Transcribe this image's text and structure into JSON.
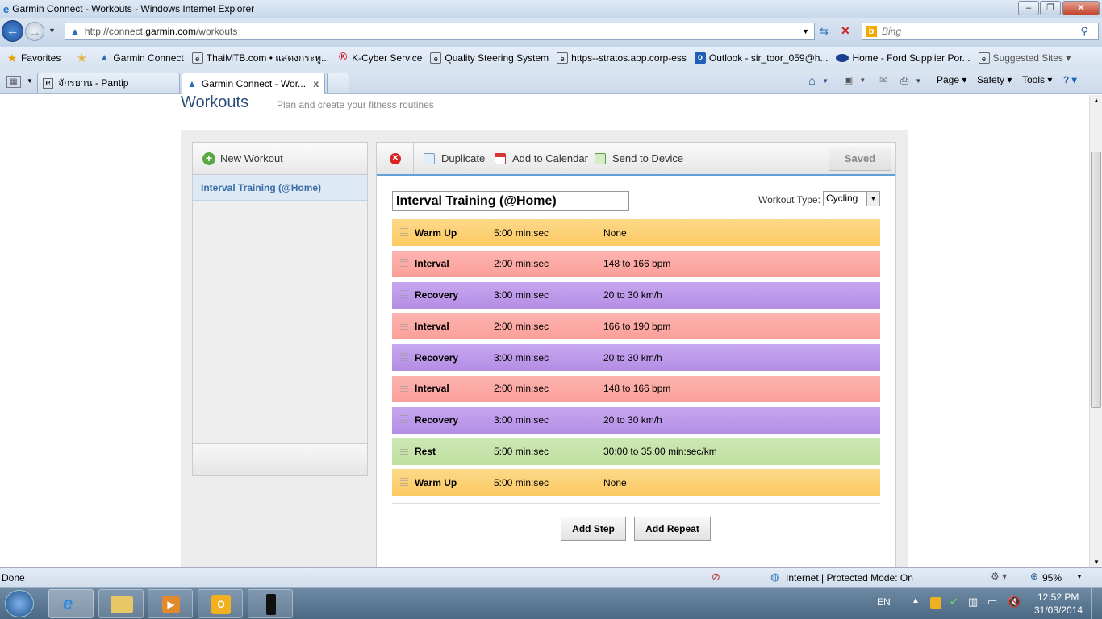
{
  "window": {
    "title": "Garmin Connect - Workouts - Windows Internet Explorer"
  },
  "address": {
    "url_prefix": "http://connect.",
    "url_domain": "garmin.com",
    "url_path": "/workouts",
    "search_placeholder": "Bing"
  },
  "favorites": {
    "label": "Favorites",
    "items": [
      "Garmin Connect",
      "ThaiMTB.com • แสดงกระทู...",
      "K-Cyber Service",
      "Quality Steering System",
      "https--stratos.app.corp-ess",
      "Outlook - sir_toor_059@h...",
      "Home - Ford Supplier Por...",
      "Suggested Sites ▾"
    ]
  },
  "tabs": [
    {
      "label": "จักรยาน - Pantip"
    },
    {
      "label": "Garmin Connect - Wor...",
      "close": "x"
    }
  ],
  "commandbar": {
    "page": "Page ▾",
    "safety": "Safety ▾",
    "tools": "Tools ▾",
    "help": "? ▾"
  },
  "header": {
    "title": "Workouts",
    "subtitle": "Plan and create your fitness routines"
  },
  "sidebar": {
    "new_workout": "New Workout",
    "selected_item": "Interval Training (@Home)"
  },
  "toolbar": {
    "duplicate": "Duplicate",
    "add_to_calendar": "Add to Calendar",
    "send_to_device": "Send to Device",
    "saved": "Saved"
  },
  "workout": {
    "name": "Interval Training (@Home)",
    "type_label": "Workout Type:",
    "type_value": "Cycling",
    "steps": [
      {
        "name": "Warm Up",
        "duration": "5:00 min:sec",
        "target": "None",
        "kind": "warm"
      },
      {
        "name": "Interval",
        "duration": "2:00 min:sec",
        "target": "148 to 166 bpm",
        "kind": "interval"
      },
      {
        "name": "Recovery",
        "duration": "3:00 min:sec",
        "target": "20 to 30 km/h",
        "kind": "recovery"
      },
      {
        "name": "Interval",
        "duration": "2:00 min:sec",
        "target": "166 to 190 bpm",
        "kind": "interval"
      },
      {
        "name": "Recovery",
        "duration": "3:00 min:sec",
        "target": "20 to 30 km/h",
        "kind": "recovery"
      },
      {
        "name": "Interval",
        "duration": "2:00 min:sec",
        "target": "148 to 166 bpm",
        "kind": "interval"
      },
      {
        "name": "Recovery",
        "duration": "3:00 min:sec",
        "target": "20 to 30 km/h",
        "kind": "recovery"
      },
      {
        "name": "Rest",
        "duration": "5:00 min:sec",
        "target": "30:00 to 35:00 min:sec/km",
        "kind": "rest"
      },
      {
        "name": "Warm Up",
        "duration": "5:00 min:sec",
        "target": "None",
        "kind": "warm"
      }
    ],
    "add_step": "Add Step",
    "add_repeat": "Add Repeat"
  },
  "statusbar": {
    "left": "Done",
    "zone": "Internet | Protected Mode: On",
    "zoom": "95%"
  },
  "taskbar": {
    "lang": "EN",
    "time": "12:52 PM",
    "date": "31/03/2014"
  }
}
